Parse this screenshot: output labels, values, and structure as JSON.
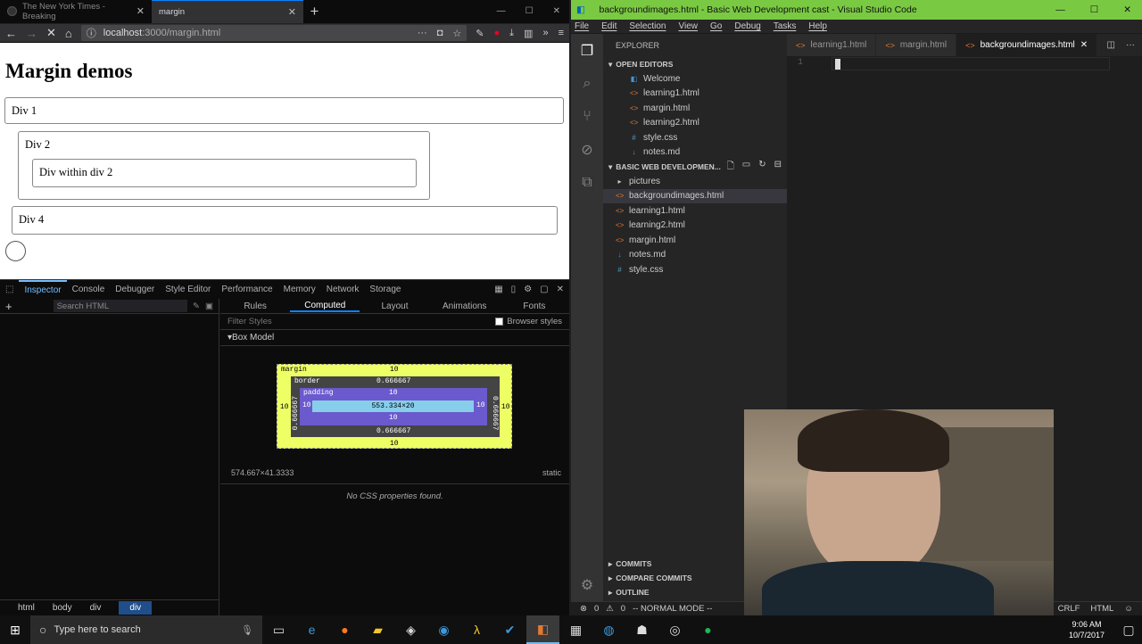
{
  "firefox": {
    "tabs": [
      {
        "title": "The New York Times - Breaking"
      },
      {
        "title": "margin"
      }
    ],
    "url_host": "localhost",
    "url_path": ":3000/margin.html"
  },
  "page": {
    "heading": "Margin demos",
    "div1": "Div 1",
    "div2": "Div 2",
    "div_within": "Div within div 2",
    "div4": "Div 4"
  },
  "devtools": {
    "tabs": [
      "Inspector",
      "Console",
      "Debugger",
      "Style Editor",
      "Performance",
      "Memory",
      "Network",
      "Storage"
    ],
    "search_placeholder": "Search HTML",
    "right_tabs": [
      "Rules",
      "Computed",
      "Layout",
      "Animations",
      "Fonts"
    ],
    "filter_placeholder": "Filter Styles",
    "browser_styles": "Browser styles",
    "box_model_title": "Box Model",
    "box": {
      "margin": "margin",
      "margin_top": "10",
      "margin_bottom": "10",
      "margin_left": "10",
      "margin_right": "10",
      "border": "border",
      "border_top": "0.666667",
      "border_bottom": "0.666667",
      "border_left": "0.666667",
      "border_right": "0.666667",
      "padding": "padding",
      "padding_top": "10",
      "padding_bottom": "10",
      "padding_left": "10",
      "padding_right": "10",
      "content": "553.334×20"
    },
    "size": "574.667×41.3333",
    "position": "static",
    "no_css": "No CSS properties found.",
    "breadcrumbs": [
      "html",
      "body",
      "div",
      "div"
    ]
  },
  "vscode": {
    "title": "backgroundimages.html - Basic Web Development cast - Visual Studio Code",
    "menu": [
      "File",
      "Edit",
      "Selection",
      "View",
      "Go",
      "Debug",
      "Tasks",
      "Help"
    ],
    "explorer": "EXPLORER",
    "open_editors": "OPEN EDITORS",
    "open_files": [
      "Welcome",
      "learning1.html",
      "margin.html",
      "learning2.html",
      "style.css",
      "notes.md"
    ],
    "project": "BASIC WEB DEVELOPMEN...",
    "project_files": [
      "pictures",
      "backgroundimages.html",
      "learning1.html",
      "learning2.html",
      "margin.html",
      "notes.md",
      "style.css"
    ],
    "sections": [
      "COMMITS",
      "COMPARE COMMITS",
      "OUTLINE"
    ],
    "editor_tabs": [
      "learning1.html",
      "margin.html",
      "backgroundimages.html"
    ],
    "line_number": "1",
    "status": {
      "errors": "0",
      "warnings": "0",
      "mode": "-- NORMAL MODE --",
      "eol": "CRLF",
      "lang": "HTML"
    }
  },
  "taskbar": {
    "search": "Type here to search",
    "time": "9:06 AM",
    "date": "10/7/2017"
  }
}
